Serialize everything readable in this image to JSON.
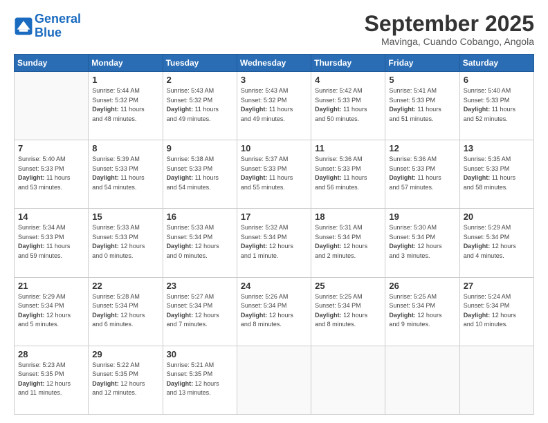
{
  "logo": {
    "line1": "General",
    "line2": "Blue"
  },
  "header": {
    "title": "September 2025",
    "location": "Mavinga, Cuando Cobango, Angola"
  },
  "days_of_week": [
    "Sunday",
    "Monday",
    "Tuesday",
    "Wednesday",
    "Thursday",
    "Friday",
    "Saturday"
  ],
  "weeks": [
    [
      {
        "day": "",
        "info": ""
      },
      {
        "day": "1",
        "info": "Sunrise: 5:44 AM\nSunset: 5:32 PM\nDaylight: 11 hours\nand 48 minutes."
      },
      {
        "day": "2",
        "info": "Sunrise: 5:43 AM\nSunset: 5:32 PM\nDaylight: 11 hours\nand 49 minutes."
      },
      {
        "day": "3",
        "info": "Sunrise: 5:43 AM\nSunset: 5:32 PM\nDaylight: 11 hours\nand 49 minutes."
      },
      {
        "day": "4",
        "info": "Sunrise: 5:42 AM\nSunset: 5:33 PM\nDaylight: 11 hours\nand 50 minutes."
      },
      {
        "day": "5",
        "info": "Sunrise: 5:41 AM\nSunset: 5:33 PM\nDaylight: 11 hours\nand 51 minutes."
      },
      {
        "day": "6",
        "info": "Sunrise: 5:40 AM\nSunset: 5:33 PM\nDaylight: 11 hours\nand 52 minutes."
      }
    ],
    [
      {
        "day": "7",
        "info": "Sunrise: 5:40 AM\nSunset: 5:33 PM\nDaylight: 11 hours\nand 53 minutes."
      },
      {
        "day": "8",
        "info": "Sunrise: 5:39 AM\nSunset: 5:33 PM\nDaylight: 11 hours\nand 54 minutes."
      },
      {
        "day": "9",
        "info": "Sunrise: 5:38 AM\nSunset: 5:33 PM\nDaylight: 11 hours\nand 54 minutes."
      },
      {
        "day": "10",
        "info": "Sunrise: 5:37 AM\nSunset: 5:33 PM\nDaylight: 11 hours\nand 55 minutes."
      },
      {
        "day": "11",
        "info": "Sunrise: 5:36 AM\nSunset: 5:33 PM\nDaylight: 11 hours\nand 56 minutes."
      },
      {
        "day": "12",
        "info": "Sunrise: 5:36 AM\nSunset: 5:33 PM\nDaylight: 11 hours\nand 57 minutes."
      },
      {
        "day": "13",
        "info": "Sunrise: 5:35 AM\nSunset: 5:33 PM\nDaylight: 11 hours\nand 58 minutes."
      }
    ],
    [
      {
        "day": "14",
        "info": "Sunrise: 5:34 AM\nSunset: 5:33 PM\nDaylight: 11 hours\nand 59 minutes."
      },
      {
        "day": "15",
        "info": "Sunrise: 5:33 AM\nSunset: 5:33 PM\nDaylight: 12 hours\nand 0 minutes."
      },
      {
        "day": "16",
        "info": "Sunrise: 5:33 AM\nSunset: 5:34 PM\nDaylight: 12 hours\nand 0 minutes."
      },
      {
        "day": "17",
        "info": "Sunrise: 5:32 AM\nSunset: 5:34 PM\nDaylight: 12 hours\nand 1 minute."
      },
      {
        "day": "18",
        "info": "Sunrise: 5:31 AM\nSunset: 5:34 PM\nDaylight: 12 hours\nand 2 minutes."
      },
      {
        "day": "19",
        "info": "Sunrise: 5:30 AM\nSunset: 5:34 PM\nDaylight: 12 hours\nand 3 minutes."
      },
      {
        "day": "20",
        "info": "Sunrise: 5:29 AM\nSunset: 5:34 PM\nDaylight: 12 hours\nand 4 minutes."
      }
    ],
    [
      {
        "day": "21",
        "info": "Sunrise: 5:29 AM\nSunset: 5:34 PM\nDaylight: 12 hours\nand 5 minutes."
      },
      {
        "day": "22",
        "info": "Sunrise: 5:28 AM\nSunset: 5:34 PM\nDaylight: 12 hours\nand 6 minutes."
      },
      {
        "day": "23",
        "info": "Sunrise: 5:27 AM\nSunset: 5:34 PM\nDaylight: 12 hours\nand 7 minutes."
      },
      {
        "day": "24",
        "info": "Sunrise: 5:26 AM\nSunset: 5:34 PM\nDaylight: 12 hours\nand 8 minutes."
      },
      {
        "day": "25",
        "info": "Sunrise: 5:25 AM\nSunset: 5:34 PM\nDaylight: 12 hours\nand 8 minutes."
      },
      {
        "day": "26",
        "info": "Sunrise: 5:25 AM\nSunset: 5:34 PM\nDaylight: 12 hours\nand 9 minutes."
      },
      {
        "day": "27",
        "info": "Sunrise: 5:24 AM\nSunset: 5:34 PM\nDaylight: 12 hours\nand 10 minutes."
      }
    ],
    [
      {
        "day": "28",
        "info": "Sunrise: 5:23 AM\nSunset: 5:35 PM\nDaylight: 12 hours\nand 11 minutes."
      },
      {
        "day": "29",
        "info": "Sunrise: 5:22 AM\nSunset: 5:35 PM\nDaylight: 12 hours\nand 12 minutes."
      },
      {
        "day": "30",
        "info": "Sunrise: 5:21 AM\nSunset: 5:35 PM\nDaylight: 12 hours\nand 13 minutes."
      },
      {
        "day": "",
        "info": ""
      },
      {
        "day": "",
        "info": ""
      },
      {
        "day": "",
        "info": ""
      },
      {
        "day": "",
        "info": ""
      }
    ]
  ]
}
